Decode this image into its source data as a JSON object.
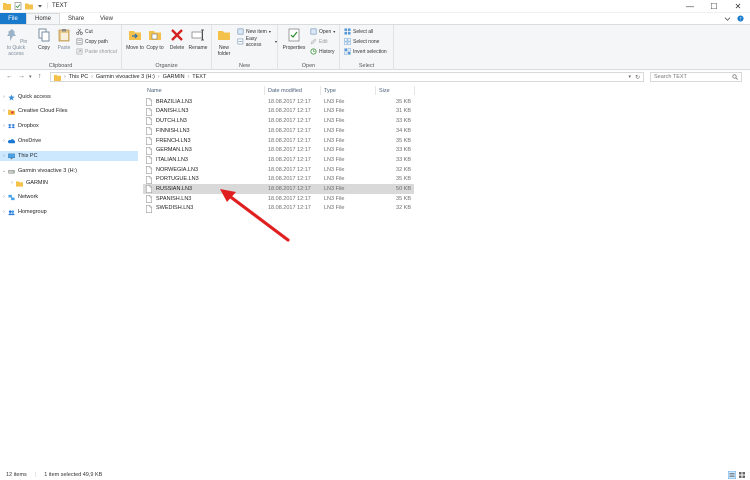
{
  "window": {
    "title": "TEXT",
    "controls": {
      "minimize": "—",
      "maximize": "☐",
      "close": "✕"
    }
  },
  "ribbon_tabs": {
    "file": "File",
    "home": "Home",
    "share": "Share",
    "view": "View"
  },
  "ribbon": {
    "clipboard": {
      "label": "Clipboard",
      "pin": "Pin to Quick access",
      "copy": "Copy",
      "paste": "Paste",
      "cut": "Cut",
      "copy_path": "Copy path",
      "paste_shortcut": "Paste shortcut"
    },
    "organize": {
      "label": "Organize",
      "move_to": "Move to",
      "copy_to": "Copy to",
      "delete": "Delete",
      "rename": "Rename"
    },
    "new": {
      "label": "New",
      "new_folder": "New folder",
      "new_item": "New item",
      "easy_access": "Easy access"
    },
    "open": {
      "label": "Open",
      "properties": "Properties",
      "open": "Open",
      "edit": "Edit",
      "history": "History"
    },
    "select": {
      "label": "Select",
      "select_all": "Select all",
      "select_none": "Select none",
      "invert_selection": "Invert selection"
    }
  },
  "address": {
    "crumbs": [
      "This PC",
      "Garmin vivoactive 3 (H:)",
      "GARMIN",
      "TEXT"
    ],
    "search_placeholder": "Search TEXT"
  },
  "nav": {
    "items": [
      {
        "label": "Quick access",
        "icon": "star-icon"
      },
      {
        "label": "Creative Cloud Files",
        "icon": "creative-cloud-icon"
      },
      {
        "label": "Dropbox",
        "icon": "dropbox-icon"
      },
      {
        "label": "OneDrive",
        "icon": "onedrive-icon"
      },
      {
        "label": "This PC",
        "icon": "pc-icon"
      },
      {
        "label": "Garmin vivoactive 3 (H:)",
        "icon": "drive-icon"
      },
      {
        "label": "GARMIN",
        "icon": "folder-icon"
      },
      {
        "label": "Network",
        "icon": "network-icon"
      },
      {
        "label": "Homegroup",
        "icon": "homegroup-icon"
      }
    ]
  },
  "filelist": {
    "headers": {
      "name": "Name",
      "date": "Date modified",
      "type": "Type",
      "size": "Size"
    },
    "rows": [
      {
        "name": "BRAZILIA.LN3",
        "date": "18.08.2017 12:17",
        "type": "LN3 File",
        "size": "35 KB"
      },
      {
        "name": "DANISH.LN3",
        "date": "18.08.2017 12:17",
        "type": "LN3 File",
        "size": "31 KB"
      },
      {
        "name": "DUTCH.LN3",
        "date": "18.08.2017 12:17",
        "type": "LN3 File",
        "size": "33 KB"
      },
      {
        "name": "FINNISH.LN3",
        "date": "18.08.2017 12:17",
        "type": "LN3 File",
        "size": "34 KB"
      },
      {
        "name": "FRENCH.LN3",
        "date": "18.08.2017 12:17",
        "type": "LN3 File",
        "size": "35 KB"
      },
      {
        "name": "GERMAN.LN3",
        "date": "18.08.2017 12:17",
        "type": "LN3 File",
        "size": "33 KB"
      },
      {
        "name": "ITALIAN.LN3",
        "date": "18.08.2017 12:17",
        "type": "LN3 File",
        "size": "33 KB"
      },
      {
        "name": "NORWEGIA.LN3",
        "date": "18.08.2017 12:17",
        "type": "LN3 File",
        "size": "32 KB"
      },
      {
        "name": "PORTUGUE.LN3",
        "date": "18.08.2017 12:17",
        "type": "LN3 File",
        "size": "35 KB"
      },
      {
        "name": "RUSSIAN.LN3",
        "date": "18.08.2017 12:17",
        "type": "LN3 File",
        "size": "50 KB"
      },
      {
        "name": "SPANISH.LN3",
        "date": "18.08.2017 12:17",
        "type": "LN3 File",
        "size": "35 KB"
      },
      {
        "name": "SWEDISH.LN3",
        "date": "18.08.2017 12:17",
        "type": "LN3 File",
        "size": "32 KB"
      }
    ]
  },
  "status": {
    "item_count": "12 items",
    "selection": "1 item selected  49,9 KB"
  },
  "colors": {
    "file_tab": "#1979ca",
    "selection": "#cce8ff",
    "selected_row": "#d9d9d9",
    "annotation_arrow": "#e02020"
  }
}
